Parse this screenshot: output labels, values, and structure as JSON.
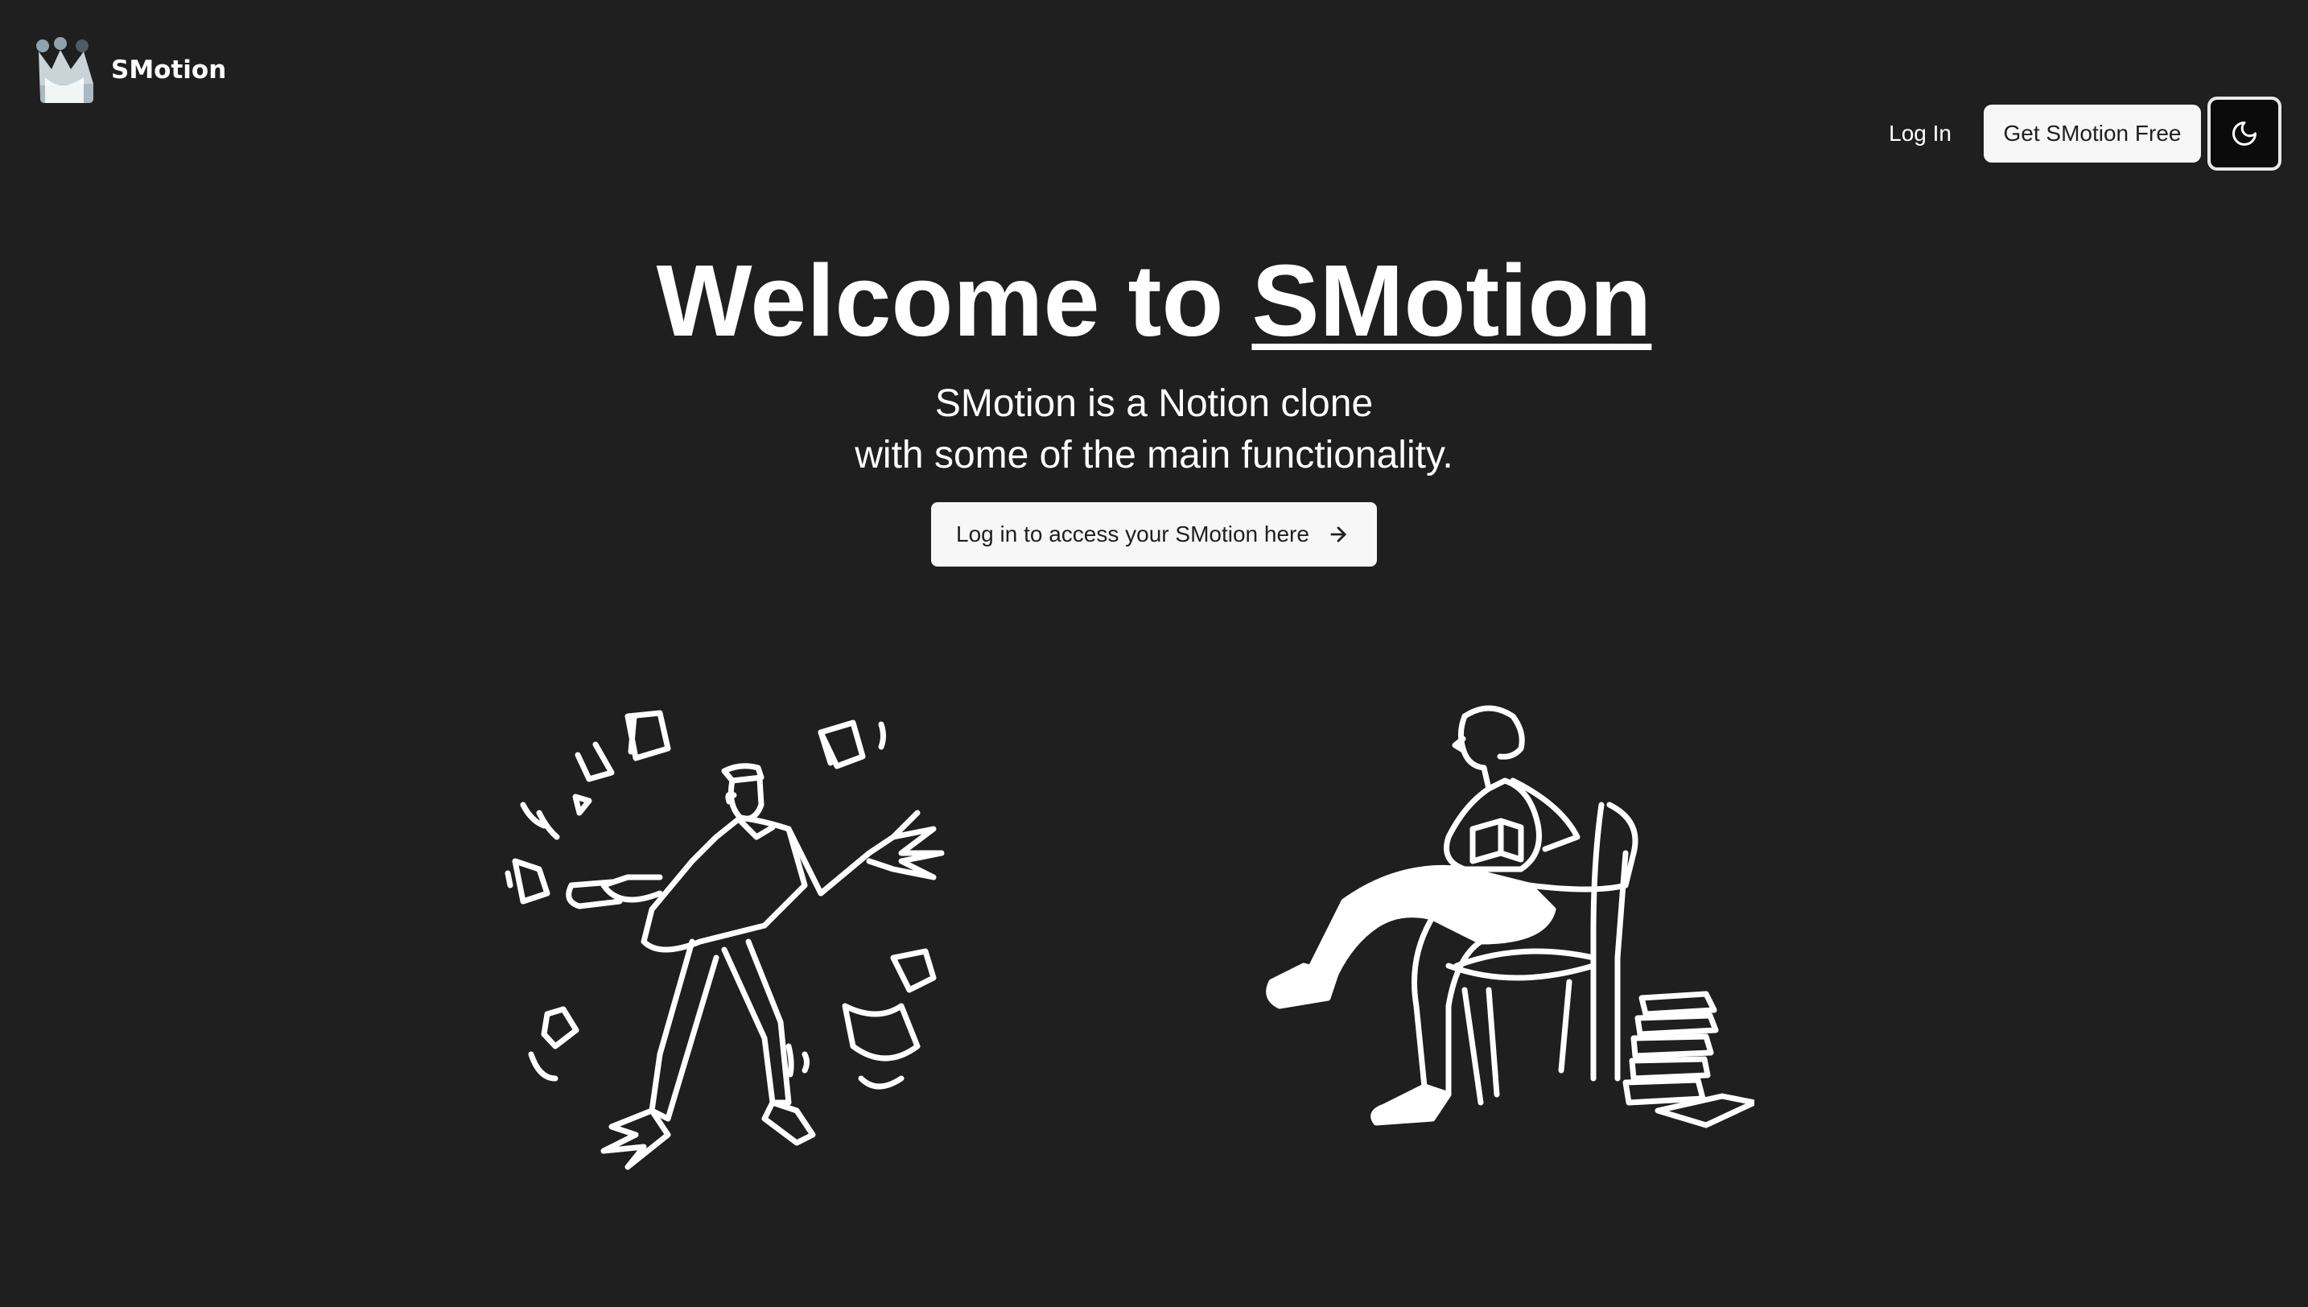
{
  "header": {
    "logo_icon": "crown-icon",
    "app_name": "SMotion",
    "login_label": "Log In",
    "get_free_label": "Get SMotion Free",
    "theme_toggle_icon": "moon-icon"
  },
  "hero": {
    "title_prefix": "Welcome to",
    "title_brand": "SMotion",
    "subtitle_line1": "SMotion is a Notion clone",
    "subtitle_line2": "with some of the main functionality.",
    "cta_label": "Log in to access your SMotion here",
    "cta_icon": "arrow-right-icon"
  },
  "illustrations": {
    "left": "person-juggling-papers-illustration",
    "right": "person-reading-in-chair-illustration"
  },
  "colors": {
    "background": "#1f1f1f",
    "text": "#ffffff",
    "button_bg": "#f7f7f7",
    "button_text": "#1f1f1f"
  }
}
